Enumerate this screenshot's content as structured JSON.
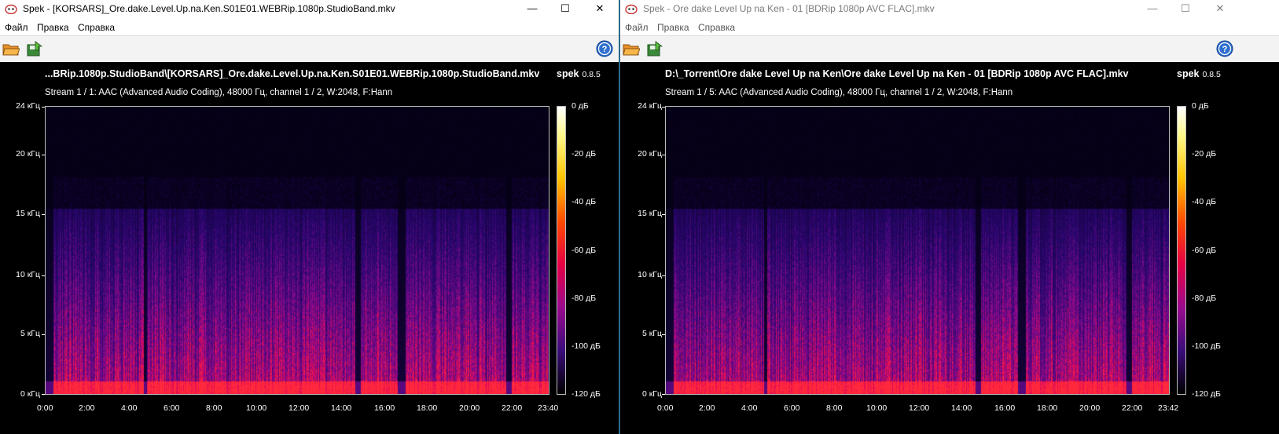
{
  "windows": [
    {
      "title": "Spek - [KORSARS]_Ore.dake.Level.Up.na.Ken.S01E01.WEBRip.1080p.StudioBand.mkv",
      "active": true,
      "menu": [
        "Файл",
        "Правка",
        "Справка"
      ],
      "file_label": "...BRip.1080p.StudioBand\\[KORSARS]_Ore.dake.Level.Up.na.Ken.S01E01.WEBRip.1080p.StudioBand.mkv",
      "logo": "spek",
      "version": "0.8.5",
      "stream_info": "Stream 1 / 1: AAC (Advanced Audio Coding), 48000 Гц, channel 1 / 2, W:2048, F:Hann",
      "freq_labels": [
        "24 кГц",
        "20 кГц",
        "15 кГц",
        "10 кГц",
        "5 кГц",
        "0 кГц"
      ],
      "time_labels": [
        "0:00",
        "2:00",
        "4:00",
        "6:00",
        "8:00",
        "10:00",
        "12:00",
        "14:00",
        "16:00",
        "18:00",
        "20:00",
        "22:00",
        "23:40"
      ],
      "db_labels": [
        "0 дБ",
        "-20 дБ",
        "-40 дБ",
        "-60 дБ",
        "-80 дБ",
        "-100 дБ",
        "-120 дБ"
      ],
      "duration_seconds": 1420,
      "cutoff_khz": 15.5
    },
    {
      "title": "Spek - Ore dake Level Up na Ken - 01 [BDRip 1080p AVC FLAC].mkv",
      "active": false,
      "menu": [
        "Файл",
        "Правка",
        "Справка"
      ],
      "file_label": "D:\\_Torrent\\Ore dake Level Up na Ken\\Ore dake Level Up na Ken - 01 [BDRip 1080p AVC FLAC].mkv",
      "logo": "spek",
      "version": "0.8.5",
      "stream_info": "Stream 1 / 5: AAC (Advanced Audio Coding), 48000 Гц, channel 1 / 2, W:2048, F:Hann",
      "freq_labels": [
        "24 кГц",
        "20 кГц",
        "15 кГц",
        "10 кГц",
        "5 кГц",
        "0 кГц"
      ],
      "time_labels": [
        "0:00",
        "2:00",
        "4:00",
        "6:00",
        "8:00",
        "10:00",
        "12:00",
        "14:00",
        "16:00",
        "18:00",
        "20:00",
        "22:00",
        "23:42"
      ],
      "db_labels": [
        "0 дБ",
        "-20 дБ",
        "-40 дБ",
        "-60 дБ",
        "-80 дБ",
        "-100 дБ",
        "-120 дБ"
      ],
      "duration_seconds": 1422,
      "cutoff_khz": 15.5
    }
  ],
  "icons": {
    "app": "spek-app-icon",
    "open": "folder-open-icon",
    "save": "save-export-icon",
    "help": "help-icon",
    "minimize": "minimize-icon",
    "maximize": "maximize-icon",
    "close": "close-icon"
  },
  "colors": {
    "window_border": "#2d6a8a",
    "background": "#000000",
    "heat_high": "#ff1a4a",
    "heat_mid": "#9a0a8e",
    "heat_low": "#1a0838"
  }
}
